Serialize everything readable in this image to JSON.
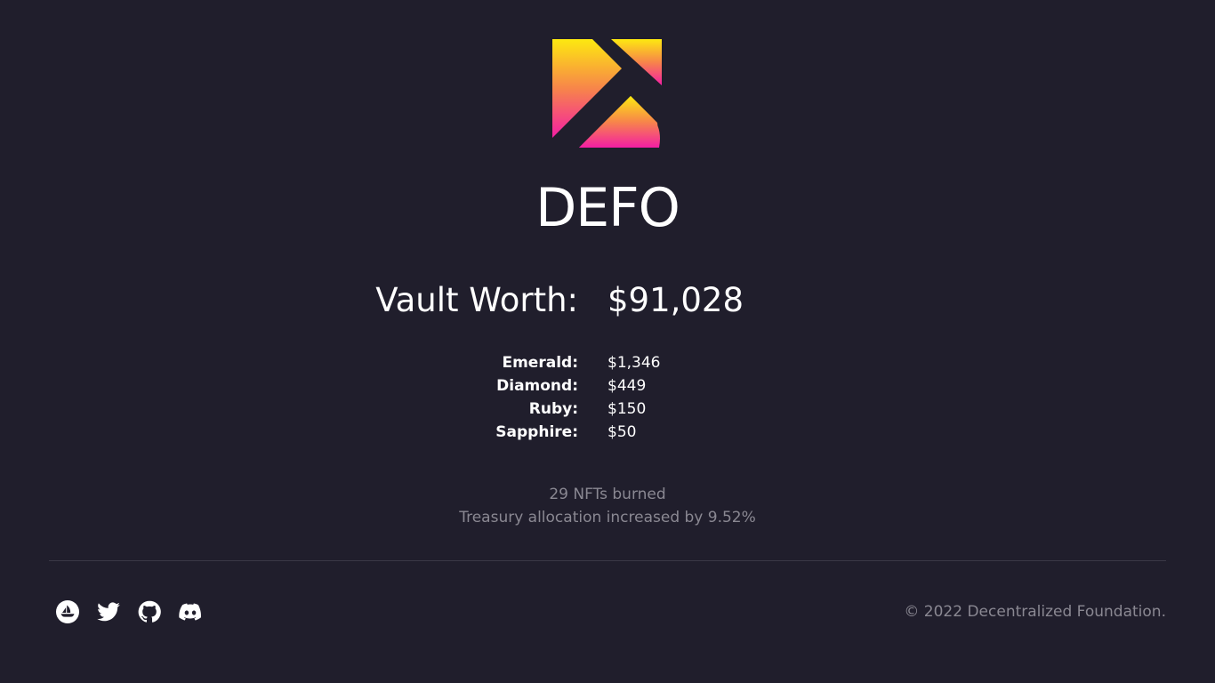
{
  "brand": {
    "title": "DEFO",
    "logo_colors": [
      "#fde910",
      "#f79a3c",
      "#f41ea4"
    ]
  },
  "vault": {
    "label": "Vault Worth:",
    "value": "$91,028"
  },
  "breakdown": [
    {
      "name": "Emerald:",
      "value": "$1,346"
    },
    {
      "name": "Diamond:",
      "value": "$449"
    },
    {
      "name": "Ruby:",
      "value": "$150"
    },
    {
      "name": "Sapphire:",
      "value": "$50"
    }
  ],
  "stats": {
    "burned": "29 NFTs burned",
    "treasury": "Treasury allocation increased by 9.52%"
  },
  "footer": {
    "social_icons": [
      "opensea-icon",
      "twitter-icon",
      "github-icon",
      "discord-icon"
    ],
    "copyright": "© 2022 Decentralized Foundation."
  }
}
